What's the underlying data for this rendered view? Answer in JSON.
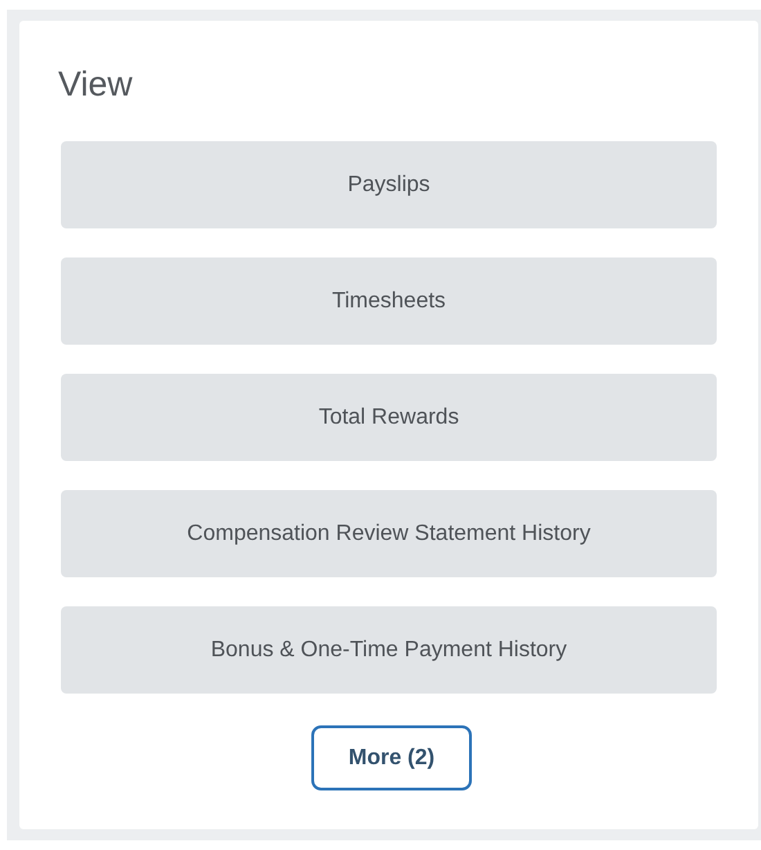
{
  "title": "View",
  "buttons": [
    {
      "label": "Payslips"
    },
    {
      "label": "Timesheets"
    },
    {
      "label": "Total Rewards"
    },
    {
      "label": "Compensation Review Statement History"
    },
    {
      "label": "Bonus & One-Time Payment History"
    }
  ],
  "more": {
    "label": "More (2)"
  }
}
